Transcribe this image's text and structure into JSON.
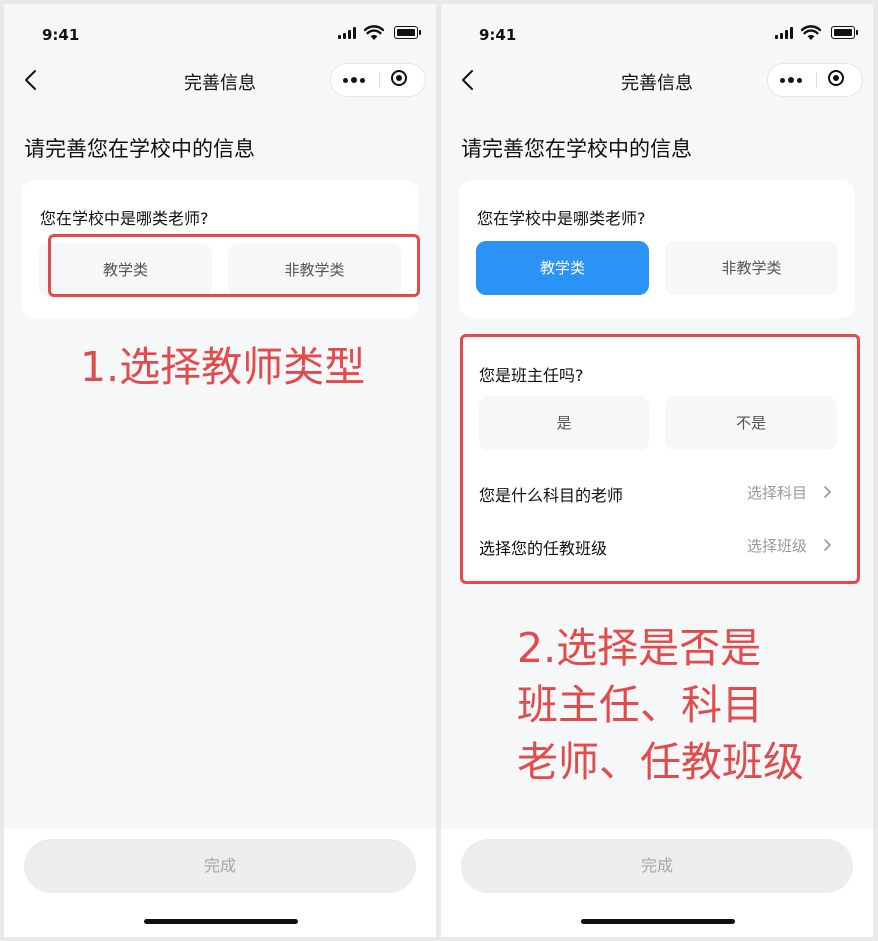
{
  "status_bar": {
    "time": "9:41"
  },
  "nav": {
    "title": "完善信息"
  },
  "heading": "请完善您在学校中的信息",
  "teacher_type": {
    "question": "您在学校中是哪类老师?",
    "options": [
      "教学类",
      "非教学类"
    ]
  },
  "left": {
    "selected_option": null,
    "annotation": "1.选择教师类型"
  },
  "right": {
    "selected_option": "教学类",
    "head_teacher": {
      "question": "您是班主任吗?",
      "options": [
        "是",
        "不是"
      ]
    },
    "subject": {
      "label": "您是什么科目的老师",
      "value": "选择科目"
    },
    "class": {
      "label": "选择您的任教班级",
      "value": "选择班级"
    },
    "annotation_lines": [
      "2.选择是否是",
      "班主任、科目",
      "老师、任教班级"
    ]
  },
  "footer": {
    "done_label": "完成"
  },
  "colors": {
    "accent": "#2a93f5",
    "annotation": "#e24b4b",
    "disabled_button": "#ededee"
  }
}
